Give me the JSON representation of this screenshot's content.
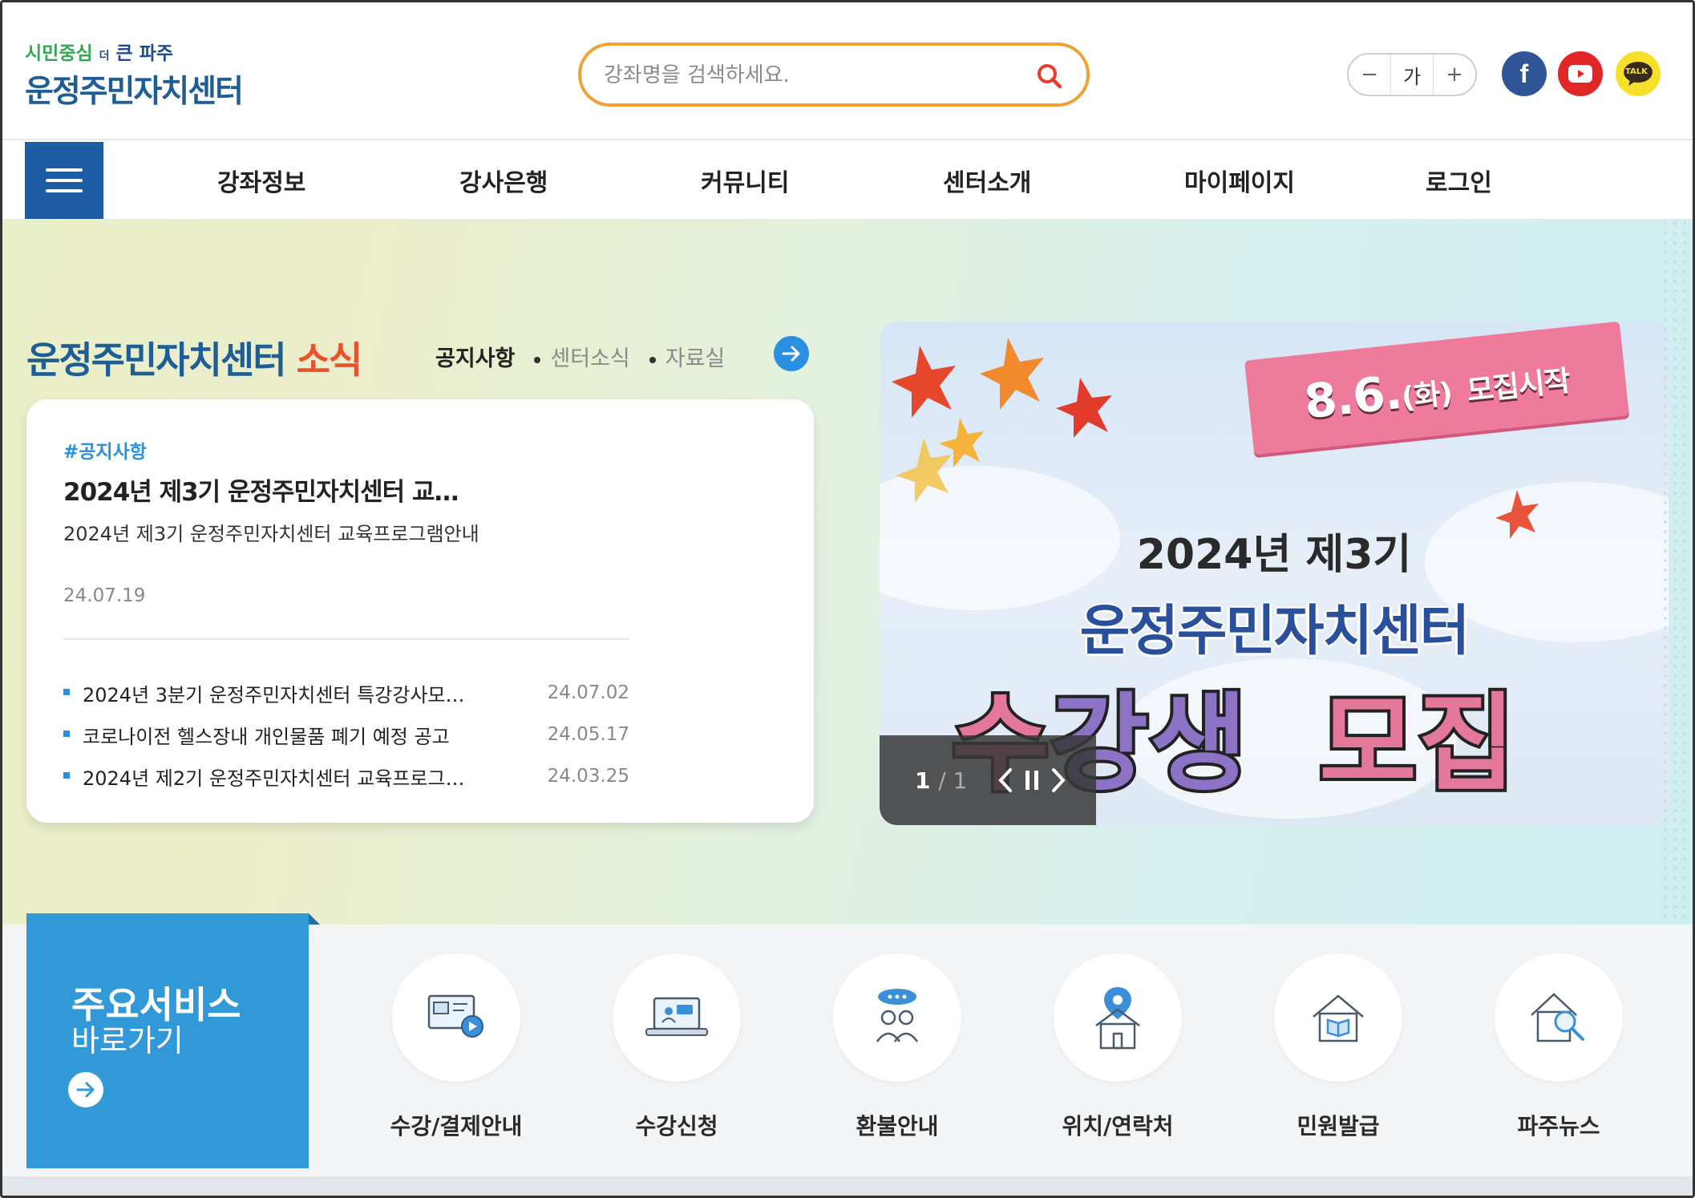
{
  "logo": {
    "tag1": "시민중심",
    "tag2": "더",
    "tag3": "큰 파주",
    "name": "운정주민자치센터"
  },
  "search": {
    "placeholder": "강좌명을 검색하세요.",
    "value": ""
  },
  "font_control": {
    "decrease": "−",
    "label": "가",
    "increase": "+"
  },
  "sns": {
    "facebook": "f",
    "kakao": "TALK"
  },
  "nav": {
    "items": [
      "강좌정보",
      "강사은행",
      "커뮤니티",
      "센터소개",
      "마이페이지",
      "로그인"
    ]
  },
  "news": {
    "title": "운정주민자치센터",
    "title_highlight": "소식",
    "tabs": [
      "공지사항",
      "센터소식",
      "자료실"
    ],
    "featured": {
      "tag": "#공지사항",
      "title": "2024년 제3기 운정주민자치센터 교…",
      "desc": "2024년 제3기 운정주민자치센터 교육프로그램안내",
      "date": "24.07.19"
    },
    "list": [
      {
        "title": "2024년 3분기 운정주민자치센터 특강강사모…",
        "date": "24.07.02"
      },
      {
        "title": "코로나이전 헬스장내 개인물품 폐기 예정 공고",
        "date": "24.05.17"
      },
      {
        "title": "2024년 제2기 운정주민자치센터 교육프로그…",
        "date": "24.03.25"
      }
    ]
  },
  "banner": {
    "ribbon_date": "8.6.",
    "ribbon_day": "(화)",
    "ribbon_text": "모집시작",
    "line1": "2024년 제3기",
    "line2": "운정주민자치센터",
    "line3_a": "수",
    "line3_b": "강생",
    "line3_c": "모집",
    "page_current": "1",
    "page_total": "/ 1"
  },
  "services": {
    "heading1": "주요서비스",
    "heading2": "바로가기",
    "items": [
      {
        "label": "수강/결제안내",
        "icon": "payment-guide-icon"
      },
      {
        "label": "수강신청",
        "icon": "course-apply-icon"
      },
      {
        "label": "환불안내",
        "icon": "refund-guide-icon"
      },
      {
        "label": "위치/연락처",
        "icon": "location-icon"
      },
      {
        "label": "민원발급",
        "icon": "civil-document-icon"
      },
      {
        "label": "파주뉴스",
        "icon": "paju-news-icon"
      }
    ]
  },
  "colors": {
    "brand_blue": "#1e5e95",
    "accent_orange": "#e9522a",
    "search_border": "#f0a131",
    "nav_button": "#1c5ca3",
    "service_blue": "#3199d8"
  }
}
